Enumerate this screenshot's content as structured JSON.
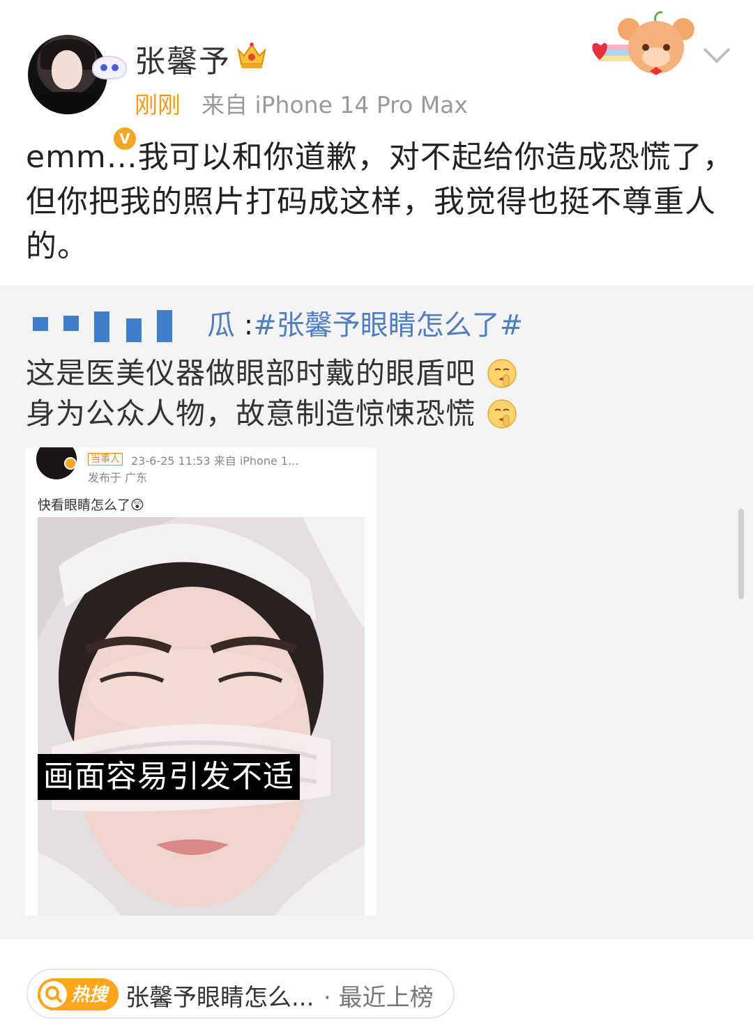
{
  "header": {
    "username": "张馨予",
    "timestamp": "刚刚",
    "source": "来自 iPhone 14 Pro Max",
    "verified_mark": "V"
  },
  "post": {
    "text": "emm…我可以和你道歉，对不起给你造成恐慌了，但你把我的照片打码成这样，我觉得也挺不尊重人的。"
  },
  "repost": {
    "user_tail": "瓜",
    "separator": " :",
    "hashtag": "#张馨予眼睛怎么了#",
    "line1": "这是医美仪器做眼部时戴的眼盾吧",
    "line2": "身为公众人物，故意制造惊悚恐慌",
    "embedded": {
      "tag": "当事人",
      "meta": "23-6-25 11:53  来自 iPhone 1...",
      "location": "发布于 广东",
      "caption": "快看眼睛怎么了😲",
      "warning": "画面容易引发不适"
    }
  },
  "hot_search": {
    "badge_label": "热搜",
    "topic": "张馨予眼睛怎么...",
    "status": "· 最近上榜"
  },
  "colors": {
    "accent_orange": "#f29a1a",
    "link_blue": "#507cc0",
    "repost_bg": "#f4f4f4",
    "hot_badge": "#ffa41b"
  },
  "icons": [
    "crown-icon",
    "verified-badge-icon",
    "bear-decoration-icon",
    "chevron-down-icon",
    "shush-emoji-icon",
    "search-icon"
  ]
}
